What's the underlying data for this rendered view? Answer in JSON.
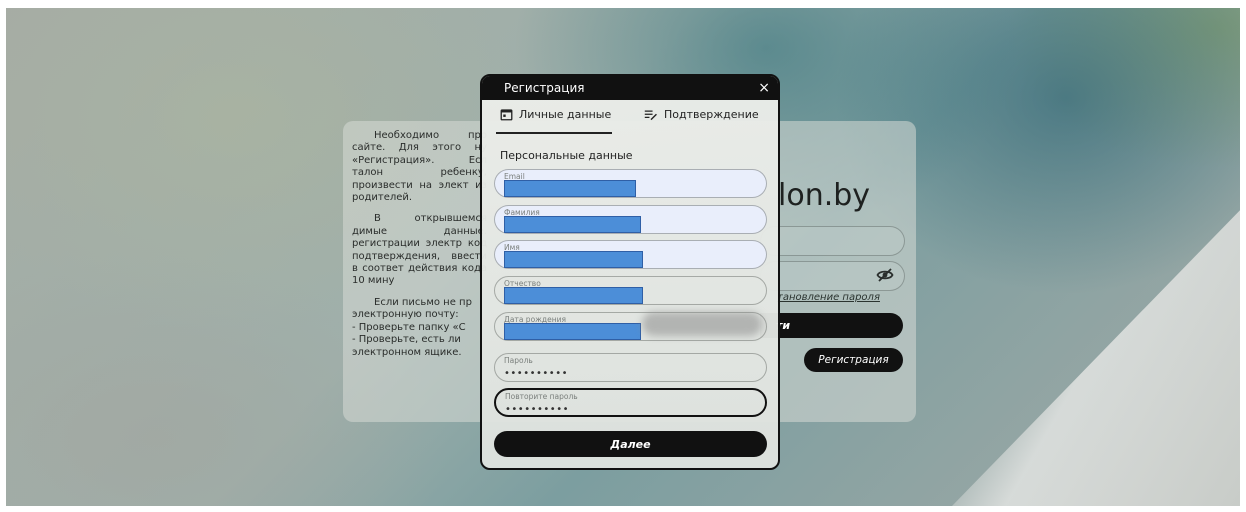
{
  "background": {
    "info": {
      "p1": "Необходимо про сайте. Для этого ну «Регистрация». Есл талон ребенку, произвести на элект из родителей.",
      "p2": "В открывшемся димые данные. регистрации электр код подтверждения, ввести в соответ действия кода 10 мину",
      "p3_line1": "Если письмо не пр",
      "p3_line2": "электронную почту:",
      "p3_line3": "- Проверьте папку «С",
      "p3_line4": "- Проверьте, есть ли",
      "p3_line5": "электронном ящике."
    },
    "logo": "lon.by",
    "forgot_password": "тановление пароля",
    "login_button": "ти",
    "register_button": "Регистрация"
  },
  "modal": {
    "title": "Регистрация",
    "close_symbol": "×",
    "tabs": [
      {
        "label": "Личные данные",
        "icon": "calendar-icon",
        "active": true
      },
      {
        "label": "Подтверждение",
        "icon": "edit-list-icon",
        "active": false
      }
    ],
    "section_title": "Персональные данные",
    "fields": [
      {
        "label": "Email"
      },
      {
        "label": "Фамилия"
      },
      {
        "label": "Имя"
      },
      {
        "label": "Отчество"
      },
      {
        "label": "Дата рождения"
      },
      {
        "label": "Пароль",
        "value": "••••••••••"
      },
      {
        "label": "Повторите пароль",
        "value": "••••••••••"
      }
    ],
    "next_button": "Далее"
  },
  "colors": {
    "dark": "#111111",
    "redaction": "#4c8ed8",
    "filled_field": "#e9eefb"
  }
}
